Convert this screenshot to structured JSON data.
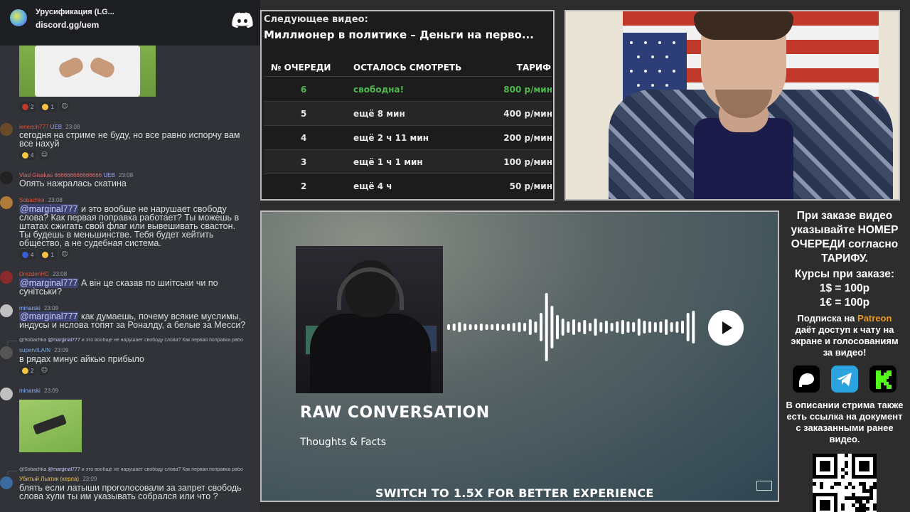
{
  "discord": {
    "server_name": "Урусификация (LG...",
    "server_link": "discord.gg/uem"
  },
  "chat": {
    "msg1_reacts": [
      "2",
      "1"
    ],
    "msg2": {
      "user": "ieneech777",
      "badge": "UEB",
      "time": "23:08",
      "text_l1": "сегодня на стриме не буду, но все равно испорчу вам",
      "text_l2": "все нахуй",
      "react": "4"
    },
    "msg3": {
      "user": "Vlad Gisakas 666666666666666",
      "badge": "UEB",
      "time": "23:08",
      "text": "Опять нажралась скатина"
    },
    "msg4": {
      "user": "Sobachka",
      "time": "23:08",
      "mention": "@marginal777",
      "text_l1": " и это вообще не нарушает свободу",
      "text_l2": "слова? Как первая поправка работает? Ты можешь в",
      "text_l3": "штатах сжигать свой флаг или вывешивать свастон.",
      "text_l4": "Ты будешь в меньшинстве. Тебя будет хейтить",
      "text_l5": "общество, а не судебная система.",
      "reacts": [
        "4",
        "1"
      ]
    },
    "msg5": {
      "user": "DrezdenHC",
      "time": "23:08",
      "mention": "@marginal777",
      "text_l1": " А він це сказав по шиітськи чи по",
      "text_l2": "сунітськи?"
    },
    "msg6": {
      "user": "minarski",
      "time": "23:09",
      "mention": "@marginal777",
      "text_l1": " как думаешь, почему всякие муслимы,",
      "text_l2": "индусы и нслова топят за Роналду, а белые за Месси?"
    },
    "msg7": {
      "reply_user": "@Sobachka",
      "reply_mention": "@marginal777",
      "reply_text": " и это вообще не нарушает свободу слова? Как первая поправка рабо",
      "user": "supervILAIN",
      "time": "23:09",
      "text": "в рядах минус айкью прибыло",
      "react": "2"
    },
    "msg8": {
      "user": "minarski",
      "time": "23:09"
    },
    "msg9": {
      "reply_user": "@Sobachka",
      "reply_mention": "@marginal777",
      "reply_text": " и это вообще не нарушает свободу слова? Как первая поправка рабо",
      "user": "Убитый Львтик (керла)",
      "time": "23:09",
      "text_l1": "блять если латыши проголосовали за запрет свободь",
      "text_l2": "слова хули ты им указывать собрался или что ?"
    }
  },
  "queue": {
    "next_label": "Следующее видео:",
    "next_title": "Миллионер в политике – Деньги на перво...",
    "headers": {
      "num": "№ ОЧЕРЕДИ",
      "left": "ОСТАЛОСЬ СМОТРЕТЬ",
      "rate": "ТАРИФ"
    },
    "rows": [
      {
        "num": "6",
        "left": "свободна!",
        "rate": "800 р/мин"
      },
      {
        "num": "5",
        "left": "ещё 8 мин",
        "rate": "400 р/мин"
      },
      {
        "num": "4",
        "left": "ещё 2 ч 11 мин",
        "rate": "200 р/мин"
      },
      {
        "num": "3",
        "left": "ещё 1 ч 1 мин",
        "rate": "100 р/мин"
      },
      {
        "num": "2",
        "left": "ещё 4 ч",
        "rate": "50 р/мин"
      }
    ]
  },
  "video": {
    "title": "RAW CONVERSATION",
    "subtitle": "Thoughts & Facts",
    "footer": "SWITCH TO 1.5X FOR BETTER EXPERIENCE"
  },
  "info": {
    "l1": "При заказе видео",
    "l2": "указывайте НОМЕР",
    "l3": "ОЧЕРЕДИ согласно",
    "l4": "ТАРИФУ.",
    "l5": "Курсы при заказе:",
    "l6": "1$ = 100р",
    "l7": "1€ = 100р",
    "sub_pre": "Подписка на ",
    "sub_brand": "Patreon",
    "sub_l2": "даёт доступ к чату на",
    "sub_l3": "экране и голосованиям",
    "sub_l4": "за видео!",
    "desc_l1": "В описании стрима также",
    "desc_l2": "есть ссылка на документ",
    "desc_l3": "с заказанными ранее",
    "desc_l4": "видео."
  },
  "colors": {
    "patreon": "#e89a1f",
    "telegram": "#2aa3df",
    "kick": "#53fc18",
    "free_row": "#4fb84f"
  }
}
